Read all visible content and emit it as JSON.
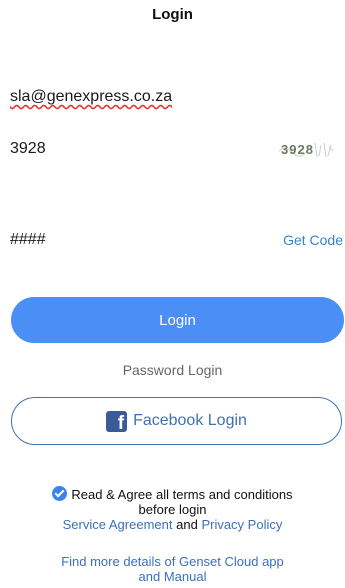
{
  "header": {
    "title": "Login"
  },
  "form": {
    "email_value": "sla@genexpress.co.za",
    "captcha_value": "3928",
    "captcha_image_text": "3928",
    "code_value": "####",
    "get_code_label": "Get Code"
  },
  "actions": {
    "login_label": "Login",
    "password_login_label": "Password Login",
    "facebook_login_label": "Facebook Login"
  },
  "agreement": {
    "checked": true,
    "text_line1": "Read & Agree all terms and conditions",
    "text_line2": "before login",
    "service_agreement_label": "Service Agreement",
    "and_text": "and",
    "privacy_policy_label": "Privacy Policy"
  },
  "footer": {
    "line1": "Find more details of Genset Cloud app",
    "line2": "and Manual"
  },
  "colors": {
    "primary": "#4b8ef5",
    "link": "#3b6fc0",
    "facebook": "#3b5b98"
  }
}
